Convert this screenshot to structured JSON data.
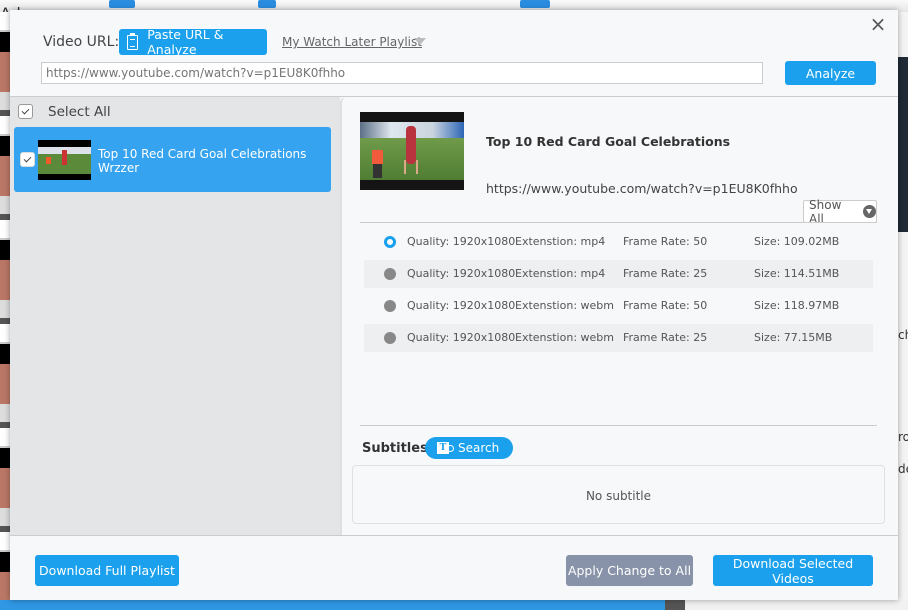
{
  "background": {
    "app_text_fragment": "Ad",
    "right_labels": [
      "ch",
      "ro",
      "de"
    ]
  },
  "dialog": {
    "close_icon": "×",
    "url_label": "Video URL:",
    "paste_button": "Paste URL & Analyze",
    "watch_later_link": "My Watch Later Playlist",
    "url_input": {
      "value": "",
      "placeholder": "https://www.youtube.com/watch?v=p1EU8K0fhho"
    },
    "analyze_button": "Analyze"
  },
  "playlist": {
    "select_all_label": "Select All",
    "select_all_checked": true,
    "items": [
      {
        "title_line1": "Top 10 Red Card Goal Celebrations",
        "title_line2": "Wrzzer",
        "checked": true,
        "selected": true
      }
    ]
  },
  "video": {
    "title": "Top 10 Red Card Goal Celebrations",
    "url": "https://www.youtube.com/watch?v=p1EU8K0fhho",
    "show_all_label": "Show All",
    "formats": [
      {
        "quality": "Quality: 1920x1080",
        "extension": "Extenstion: mp4",
        "frame_rate": "Frame Rate: 50",
        "size": "Size: 109.02MB",
        "selected": true
      },
      {
        "quality": "Quality: 1920x1080",
        "extension": "Extenstion: mp4",
        "frame_rate": "Frame Rate: 25",
        "size": "Size: 114.51MB",
        "selected": false
      },
      {
        "quality": "Quality: 1920x1080",
        "extension": "Extenstion: webm",
        "frame_rate": "Frame Rate: 50",
        "size": "Size: 118.97MB",
        "selected": false
      },
      {
        "quality": "Quality: 1920x1080",
        "extension": "Extenstion: webm",
        "frame_rate": "Frame Rate: 25",
        "size": "Size: 77.15MB",
        "selected": false
      }
    ]
  },
  "subtitles": {
    "label": "Subtitles",
    "search_button": "Search",
    "search_icon_glyph": "T",
    "empty_text": "No subtitle"
  },
  "footer": {
    "download_full_playlist": "Download Full Playlist",
    "apply_change_to_all": "Apply Change to All",
    "download_selected_videos": "Download Selected Videos"
  },
  "colors": {
    "accent": "#1aa0ec",
    "selected_item": "#36a3f0",
    "secondary_button": "#8892a8"
  }
}
